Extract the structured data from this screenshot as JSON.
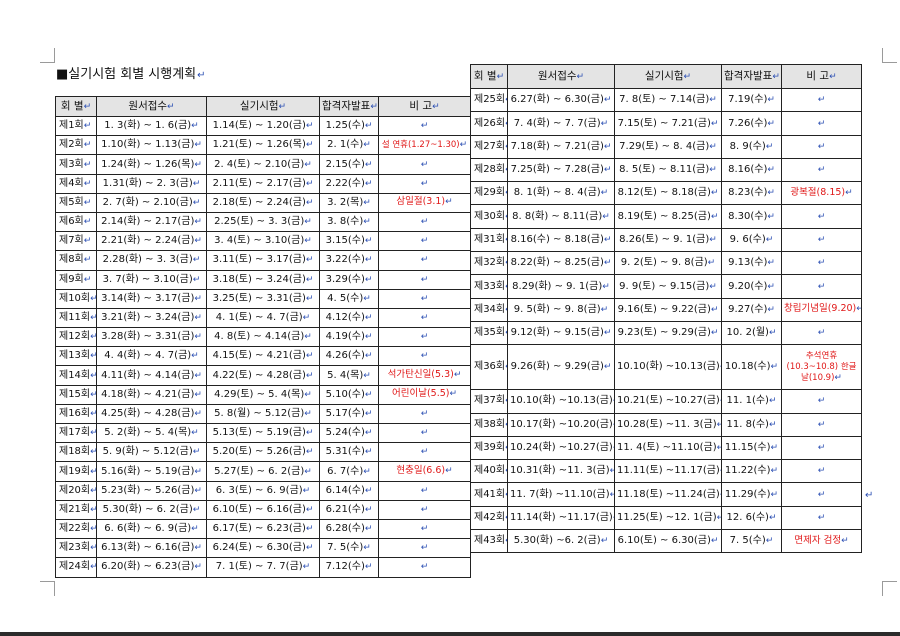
{
  "title": "■실기시험 회별 시행계획",
  "return_mark": "↵",
  "headers": [
    "회 별",
    "원서접수",
    "실기시험",
    "합격자발표",
    "비    고"
  ],
  "left_rows": [
    [
      "제1회",
      "1. 3(화) ~ 1. 6(금)",
      "1.14(토) ~ 1.20(금)",
      "1.25(수)",
      ""
    ],
    [
      "제2회",
      "1.10(화) ~ 1.13(금)",
      "1.21(토) ~ 1.26(목)",
      "2. 1(수)",
      "설 연휴(1.27~1.30)"
    ],
    [
      "제3회",
      "1.24(화) ~ 1.26(목)",
      "2. 4(토) ~ 2.10(금)",
      "2.15(수)",
      ""
    ],
    [
      "제4회",
      "1.31(화) ~ 2. 3(금)",
      "2.11(토) ~ 2.17(금)",
      "2.22(수)",
      ""
    ],
    [
      "제5회",
      "2. 7(화) ~ 2.10(금)",
      "2.18(토) ~ 2.24(금)",
      "3. 2(목)",
      "삼일절(3.1)"
    ],
    [
      "제6회",
      "2.14(화) ~ 2.17(금)",
      "2.25(토) ~ 3. 3(금)",
      "3. 8(수)",
      ""
    ],
    [
      "제7회",
      "2.21(화) ~ 2.24(금)",
      "3. 4(토) ~ 3.10(금)",
      "3.15(수)",
      ""
    ],
    [
      "제8회",
      "2.28(화) ~ 3. 3(금)",
      "3.11(토) ~ 3.17(금)",
      "3.22(수)",
      ""
    ],
    [
      "제9회",
      "3. 7(화) ~ 3.10(금)",
      "3.18(토) ~ 3.24(금)",
      "3.29(수)",
      ""
    ],
    [
      "제10회",
      "3.14(화) ~ 3.17(금)",
      "3.25(토) ~ 3.31(금)",
      "4. 5(수)",
      ""
    ],
    [
      "제11회",
      "3.21(화) ~ 3.24(금)",
      "4. 1(토) ~ 4. 7(금)",
      "4.12(수)",
      ""
    ],
    [
      "제12회",
      "3.28(화) ~ 3.31(금)",
      "4. 8(토) ~ 4.14(금)",
      "4.19(수)",
      ""
    ],
    [
      "제13회",
      "4. 4(화) ~ 4. 7(금)",
      "4.15(토) ~ 4.21(금)",
      "4.26(수)",
      ""
    ],
    [
      "제14회",
      "4.11(화) ~ 4.14(금)",
      "4.22(토) ~ 4.28(금)",
      "5. 4(목)",
      "석가탄신일(5.3)"
    ],
    [
      "제15회",
      "4.18(화) ~ 4.21(금)",
      "4.29(토) ~ 5. 4(목)",
      "5.10(수)",
      "어린이날(5.5)"
    ],
    [
      "제16회",
      "4.25(화) ~ 4.28(금)",
      "5. 8(월) ~ 5.12(금)",
      "5.17(수)",
      ""
    ],
    [
      "제17회",
      "5. 2(화) ~ 5. 4(목)",
      "5.13(토) ~ 5.19(금)",
      "5.24(수)",
      ""
    ],
    [
      "제18회",
      "5. 9(화) ~ 5.12(금)",
      "5.20(토) ~ 5.26(금)",
      "5.31(수)",
      ""
    ],
    [
      "제19회",
      "5.16(화) ~ 5.19(금)",
      "5.27(토) ~ 6. 2(금)",
      "6. 7(수)",
      "현충일(6.6)"
    ],
    [
      "제20회",
      "5.23(화) ~ 5.26(금)",
      "6. 3(토) ~ 6. 9(금)",
      "6.14(수)",
      ""
    ],
    [
      "제21회",
      "5.30(화) ~ 6. 2(금)",
      "6.10(토) ~ 6.16(금)",
      "6.21(수)",
      ""
    ],
    [
      "제22회",
      "6. 6(화) ~ 6. 9(금)",
      "6.17(토) ~ 6.23(금)",
      "6.28(수)",
      ""
    ],
    [
      "제23회",
      "6.13(화) ~ 6.16(금)",
      "6.24(토) ~ 6.30(금)",
      "7. 5(수)",
      ""
    ],
    [
      "제24회",
      "6.20(화) ~ 6.23(금)",
      "7. 1(토) ~ 7. 7(금)",
      "7.12(수)",
      ""
    ]
  ],
  "right_rows": [
    [
      "제25회",
      "6.27(화) ~ 6.30(금)",
      "7. 8(토) ~ 7.14(금)",
      "7.19(수)",
      ""
    ],
    [
      "제26회",
      "7. 4(화) ~ 7. 7(금)",
      "7.15(토) ~ 7.21(금)",
      "7.26(수)",
      ""
    ],
    [
      "제27회",
      "7.18(화) ~ 7.21(금)",
      "7.29(토) ~ 8. 4(금)",
      "8. 9(수)",
      ""
    ],
    [
      "제28회",
      "7.25(화) ~ 7.28(금)",
      "8. 5(토) ~ 8.11(금)",
      "8.16(수)",
      ""
    ],
    [
      "제29회",
      "8. 1(화) ~ 8. 4(금)",
      "8.12(토) ~ 8.18(금)",
      "8.23(수)",
      "광복절(8.15)"
    ],
    [
      "제30회",
      "8. 8(화) ~ 8.11(금)",
      "8.19(토) ~ 8.25(금)",
      "8.30(수)",
      ""
    ],
    [
      "제31회",
      "8.16(수) ~ 8.18(금)",
      "8.26(토) ~ 9. 1(금)",
      "9. 6(수)",
      ""
    ],
    [
      "제32회",
      "8.22(화) ~ 8.25(금)",
      "9. 2(토) ~ 9. 8(금)",
      "9.13(수)",
      ""
    ],
    [
      "제33회",
      "8.29(화) ~ 9. 1(금)",
      "9. 9(토) ~ 9.15(금)",
      "9.20(수)",
      ""
    ],
    [
      "제34회",
      "9. 5(화) ~ 9. 8(금)",
      "9.16(토) ~ 9.22(금)",
      "9.27(수)",
      "창립기념일(9.20)"
    ],
    [
      "제35회",
      "9.12(화) ~ 9.15(금)",
      "9.23(토) ~ 9.29(금)",
      "10. 2(월)",
      ""
    ],
    [
      "제36회",
      "9.26(화) ~ 9.29(금)",
      "10.10(화) ~10.13(금)",
      "10.18(수)",
      "추석연휴(10.3~10.8) 한글날(10.9)"
    ],
    [
      "제37회",
      "10.10(화) ~10.13(금)",
      "10.21(토) ~10.27(금)",
      "11. 1(수)",
      ""
    ],
    [
      "제38회",
      "10.17(화) ~10.20(금)",
      "10.28(토) ~11. 3(금)",
      "11. 8(수)",
      ""
    ],
    [
      "제39회",
      "10.24(화) ~10.27(금)",
      "11. 4(토) ~11.10(금)",
      "11.15(수)",
      ""
    ],
    [
      "제40회",
      "10.31(화) ~11. 3(금)",
      "11.11(토) ~11.17(금)",
      "11.22(수)",
      ""
    ],
    [
      "제41회",
      "11. 7(화) ~11.10(금)",
      "11.18(토) ~11.24(금)",
      "11.29(수)",
      ""
    ],
    [
      "제42회",
      "11.14(화) ~11.17(금)",
      "11.25(토) ~12. 1(금)",
      "12. 6(수)",
      ""
    ],
    [
      "제43회",
      "5.30(화) ~6. 2(금)",
      "6.10(토) ~ 6.30(금)",
      "7. 5(수)",
      "면제자 검정"
    ]
  ]
}
